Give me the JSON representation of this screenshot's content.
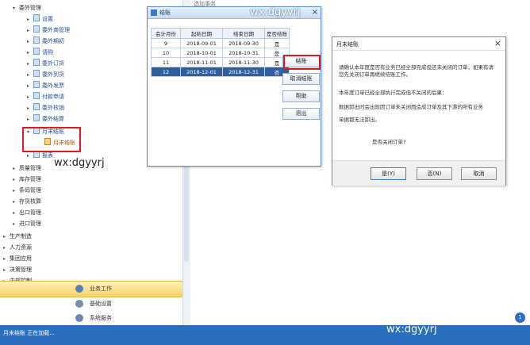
{
  "sidebar": {
    "items": [
      {
        "label": "委外管理",
        "level": "level1",
        "arrow": "▾"
      },
      {
        "label": "设置",
        "level": "level2",
        "arrow": "▸"
      },
      {
        "label": "委外商管理",
        "level": "level2",
        "arrow": "▸"
      },
      {
        "label": "委外期初",
        "level": "level2",
        "arrow": "▸"
      },
      {
        "label": "请购",
        "level": "level2",
        "arrow": "▸"
      },
      {
        "label": "委外订货",
        "level": "level2",
        "arrow": "▸"
      },
      {
        "label": "委外到货",
        "level": "level2",
        "arrow": "▸"
      },
      {
        "label": "委外发票",
        "level": "level2",
        "arrow": "▸"
      },
      {
        "label": "付款申请",
        "level": "level2",
        "arrow": "▸"
      },
      {
        "label": "委外核销",
        "level": "level2",
        "arrow": "▸"
      },
      {
        "label": "委外结算",
        "level": "level2",
        "arrow": "▸"
      },
      {
        "label": "月末结账",
        "level": "level2",
        "arrow": "▾"
      },
      {
        "label": "月末结账",
        "level": "level3",
        "arrow": ""
      },
      {
        "label": "报表",
        "level": "level2",
        "arrow": "▸"
      },
      {
        "label": "质量管理",
        "level": "level1",
        "arrow": "▸"
      },
      {
        "label": "库存管理",
        "level": "level1",
        "arrow": "▸"
      },
      {
        "label": "条码管理",
        "level": "level1",
        "arrow": "▸"
      },
      {
        "label": "存货核算",
        "level": "level1",
        "arrow": "▸"
      },
      {
        "label": "出口管理",
        "level": "level1",
        "arrow": "▸"
      },
      {
        "label": "进口管理",
        "level": "level1",
        "arrow": "▸"
      },
      {
        "label": "生产制造",
        "level": "level0",
        "arrow": "▸"
      },
      {
        "label": "人力资源",
        "level": "level0",
        "arrow": "▸"
      },
      {
        "label": "集团应用",
        "level": "level0",
        "arrow": "▸"
      },
      {
        "label": "决策管理",
        "level": "level0",
        "arrow": "▸"
      },
      {
        "label": "内部控制",
        "level": "level0",
        "arrow": "▸"
      }
    ],
    "nav": {
      "business": "业务工作",
      "basic": "基础设置",
      "system": "系统服务"
    }
  },
  "main": {
    "tab": "选加事务"
  },
  "settle_dialog": {
    "title": "结账",
    "columns": [
      "会计月份",
      "起始日期",
      "结束日期",
      "是否结账"
    ],
    "rows": [
      [
        "9",
        "2018-09-01",
        "2018-09-30",
        "是"
      ],
      [
        "10",
        "2018-10-01",
        "2018-10-31",
        "是"
      ],
      [
        "11",
        "2018-11-01",
        "2018-11-30",
        "是"
      ],
      [
        "12",
        "2018-12-01",
        "2018-12-31",
        "否"
      ]
    ],
    "buttons": {
      "settle": "结账",
      "cancel_settle": "取消结账",
      "help": "帮助",
      "exit": "退出"
    }
  },
  "confirm_dialog": {
    "title": "月末结账",
    "message1": "请确认本年度是否有业务已经全部完成但还未关闭的订单，如果有请您先关闭订单再继续结账工作。",
    "message2": "本年度订单已经全部执行完成但不关闭的后果：",
    "message3": "数据卸出时会出现因订单未关闭而造成订单及其下游的所有业务",
    "message4": "单据都无法卸出。",
    "question": "是否关闭订单?",
    "yes": "是(Y)",
    "no": "否(N)",
    "cancel": "取消"
  },
  "watermarks": [
    "wx:dgyyrj",
    "wx:dgyyrj",
    "wx:dgyyrj"
  ],
  "status": {
    "text": "月末结账 正在加载...",
    "badge": "1"
  }
}
